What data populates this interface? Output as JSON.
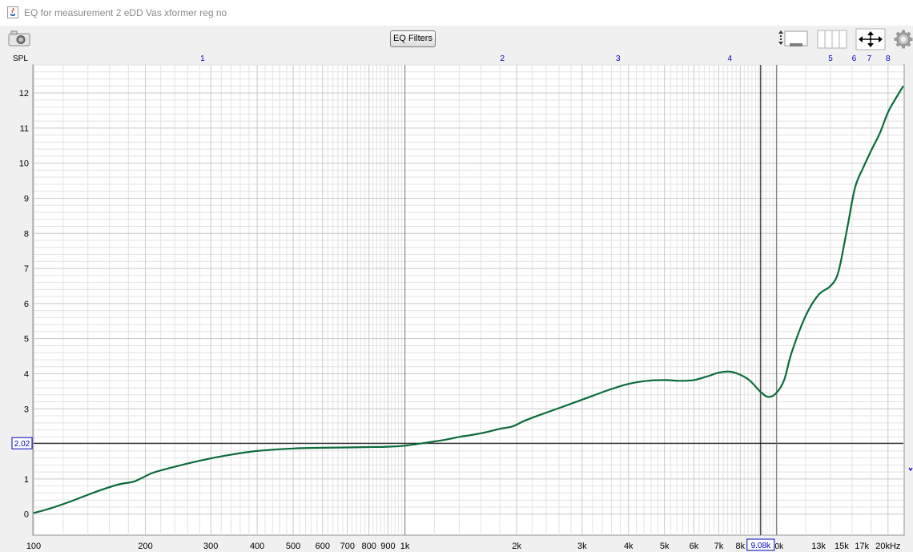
{
  "window": {
    "title": "EQ for measurement 2 eDD Vas xformer reg no"
  },
  "toolbar": {
    "eq_filters_label": "EQ Filters"
  },
  "icons": {
    "app": "java-icon",
    "camera": "camera-icon",
    "zoom": "vertical-zoom-icon",
    "columns": "columns-icon",
    "pan": "pan-arrows-icon",
    "settings": "gear-icon"
  },
  "colors": {
    "curve": "#0b6b3a",
    "top_markers": "#0000c0",
    "cursor_box": "#0000c0",
    "grid_major": "#c8c8c8",
    "grid_minor": "#e2e2e2"
  },
  "top_markers": [
    {
      "label": "1",
      "freq": 285
    },
    {
      "label": "2",
      "freq": 1830
    },
    {
      "label": "3",
      "freq": 3750
    },
    {
      "label": "4",
      "freq": 7500
    },
    {
      "label": "5",
      "freq": 14000
    },
    {
      "label": "6",
      "freq": 16200
    },
    {
      "label": "7",
      "freq": 17800
    },
    {
      "label": "8",
      "freq": 20000
    }
  ],
  "cursor": {
    "freq": 9080,
    "freq_label": "9.08k",
    "y": 2.02,
    "y_label": "2.02",
    "partial_label": "0k"
  },
  "chart_data": {
    "type": "line",
    "title": "",
    "ylabel": "SPL",
    "xlabel": "",
    "xscale": "log",
    "xlim": [
      100,
      22000
    ],
    "ylim": [
      -0.6,
      12.8
    ],
    "grid": true,
    "y_ticks": [
      "0",
      "1",
      "2",
      "3",
      "4",
      "5",
      "6",
      "7",
      "8",
      "9",
      "10",
      "11",
      "12"
    ],
    "x_ticks": [
      {
        "label": "100",
        "value": 100
      },
      {
        "label": "200",
        "value": 200
      },
      {
        "label": "300",
        "value": 300
      },
      {
        "label": "400",
        "value": 400
      },
      {
        "label": "500",
        "value": 500
      },
      {
        "label": "600",
        "value": 600
      },
      {
        "label": "700",
        "value": 700
      },
      {
        "label": "800",
        "value": 800
      },
      {
        "label": "900",
        "value": 900
      },
      {
        "label": "1k",
        "value": 1000
      },
      {
        "label": "2k",
        "value": 2000
      },
      {
        "label": "3k",
        "value": 3000
      },
      {
        "label": "4k",
        "value": 4000
      },
      {
        "label": "5k",
        "value": 5000
      },
      {
        "label": "6k",
        "value": 6000
      },
      {
        "label": "7k",
        "value": 7000
      },
      {
        "label": "8k",
        "value": 8000
      },
      {
        "label": "13k",
        "value": 13000
      },
      {
        "label": "15k",
        "value": 15000
      },
      {
        "label": "17k",
        "value": 17000
      },
      {
        "label": "20kHz",
        "value": 20000
      }
    ],
    "series": [
      {
        "x": [
          100,
          110,
          125,
          140,
          155,
          170,
          185,
          195,
          210,
          240,
          280,
          330,
          400,
          500,
          600,
          700,
          800,
          900,
          1000,
          1100,
          1200,
          1300,
          1400,
          1500,
          1650,
          1800,
          1950,
          2100,
          2300,
          2600,
          3000,
          3500,
          4000,
          4500,
          5000,
          5500,
          6000,
          6500,
          7000,
          7500,
          8000,
          8500,
          9000,
          9500,
          10000,
          10500,
          11000,
          12000,
          13000,
          14000,
          14700,
          15500,
          16300,
          17200,
          18000,
          19000,
          20000,
          21000,
          22000
        ],
        "y": [
          0.03,
          0.15,
          0.35,
          0.55,
          0.72,
          0.85,
          0.92,
          1.02,
          1.18,
          1.35,
          1.52,
          1.67,
          1.8,
          1.87,
          1.89,
          1.9,
          1.91,
          1.92,
          1.95,
          2.01,
          2.07,
          2.13,
          2.2,
          2.25,
          2.33,
          2.43,
          2.5,
          2.66,
          2.82,
          3.02,
          3.26,
          3.52,
          3.71,
          3.8,
          3.82,
          3.8,
          3.82,
          3.92,
          4.03,
          4.06,
          3.97,
          3.8,
          3.52,
          3.34,
          3.45,
          3.82,
          4.6,
          5.65,
          6.25,
          6.5,
          6.9,
          8.1,
          9.3,
          9.9,
          10.35,
          10.85,
          11.45,
          11.85,
          12.2
        ]
      }
    ]
  }
}
